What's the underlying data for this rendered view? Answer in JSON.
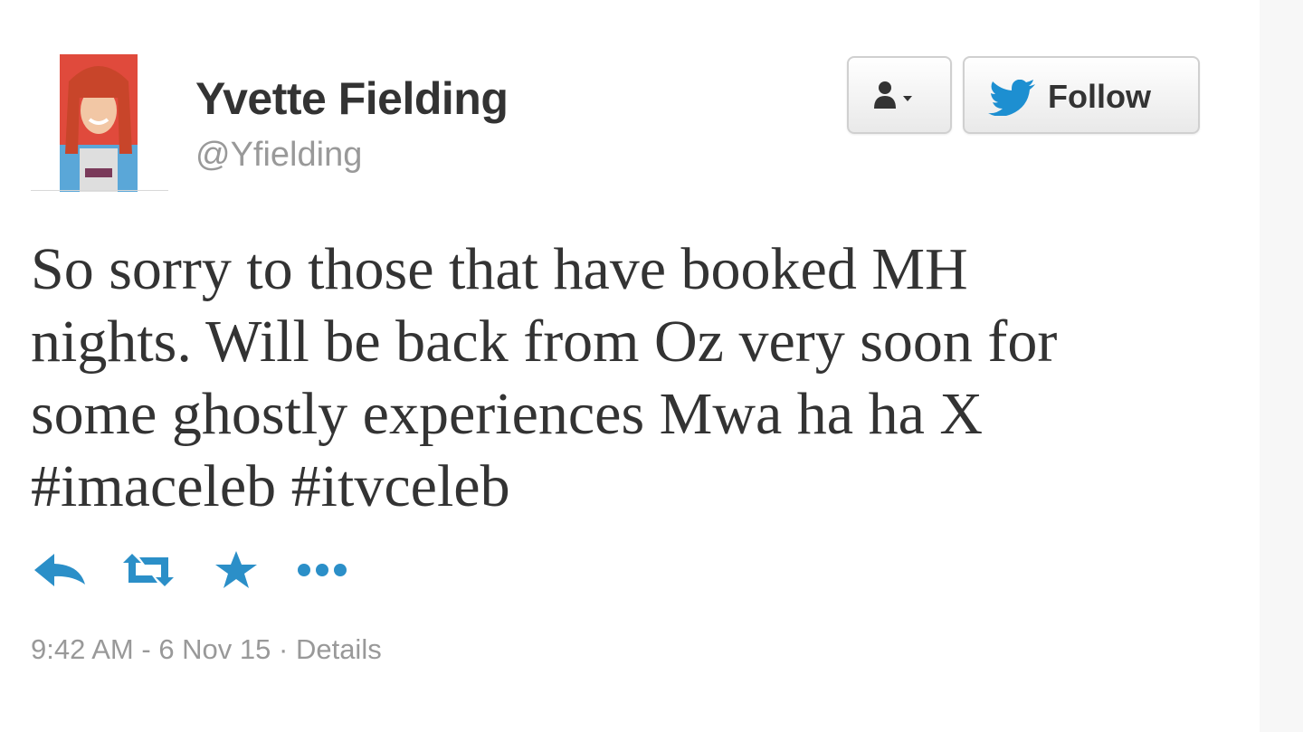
{
  "tweet": {
    "user": {
      "display_name": "Yvette Fielding",
      "handle": "@Yfielding"
    },
    "buttons": {
      "follow_label": "Follow"
    },
    "text_lines": [
      "So sorry to those that have booked MH",
      "nights. Will be back from Oz very soon for",
      "some ghostly experiences Mwa ha ha X",
      "#imaceleb #itvceleb"
    ],
    "actions": [
      "reply-icon",
      "retweet-icon",
      "favorite-icon",
      "more-icon"
    ],
    "time": "9:42 AM",
    "date": "6 Nov 15",
    "separator_dash": " - ",
    "separator_dot": " · ",
    "details_label": "Details"
  },
  "colors": {
    "twitter_blue": "#1d8fd1",
    "action_blue": "#2b8fc8",
    "text": "#333333",
    "muted": "#999999"
  }
}
